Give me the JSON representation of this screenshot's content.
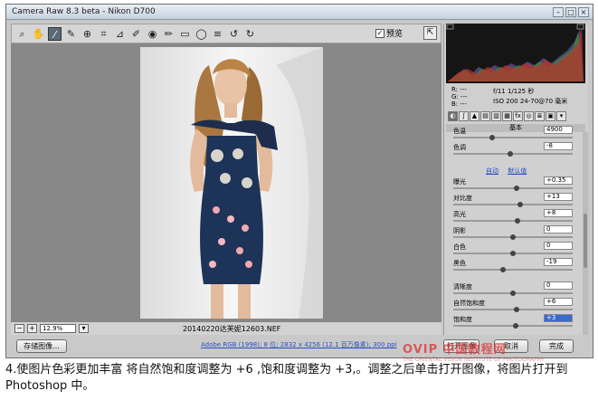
{
  "window": {
    "title": "Camera Raw 8.3 beta - Nikon D700"
  },
  "toolbar": {
    "tools": [
      "zoom-icon",
      "hand-icon",
      "white-balance-icon",
      "color-sampler-icon",
      "target-adjust-icon",
      "crop-icon",
      "straighten-icon",
      "spot-removal-icon",
      "red-eye-icon",
      "adjustment-brush-icon",
      "graduated-filter-icon",
      "radial-filter-icon",
      "preferences-icon",
      "rotate-ccw-icon",
      "rotate-cw-icon"
    ],
    "preview_label": "预览",
    "preview_checked": "✓"
  },
  "histogram": {
    "r": "R:  ---",
    "g": "G:  ---",
    "b": "B:  ---"
  },
  "exif": {
    "line1": "f/11  1/125 秒",
    "line2": "ISO 200  24-70@70 毫米"
  },
  "panel": {
    "section_title": "基本",
    "top_values": {
      "temp_label": "色温",
      "temp_value": "4900",
      "tint_label": "色调",
      "tint_value": "-8"
    },
    "auto_link": "自动",
    "default_link": "默认值",
    "sliders": [
      {
        "label": "曝光",
        "value": "+0.35",
        "pos": 0.53
      },
      {
        "label": "对比度",
        "value": "+13",
        "pos": 0.56
      },
      {
        "label": "高光",
        "value": "+8",
        "pos": 0.54
      },
      {
        "label": "阴影",
        "value": "0",
        "pos": 0.5
      },
      {
        "label": "白色",
        "value": "0",
        "pos": 0.5
      },
      {
        "label": "黑色",
        "value": "-19",
        "pos": 0.41
      },
      {
        "label": "清晰度",
        "value": "0",
        "pos": 0.5
      },
      {
        "label": "自然饱和度",
        "value": "+6",
        "pos": 0.53
      },
      {
        "label": "饱和度",
        "value": "+3",
        "pos": 0.52
      }
    ]
  },
  "zoom": {
    "value": "12.9%",
    "minus": "−",
    "plus": "+"
  },
  "file": {
    "name": "20140220达芙妮12603.NEF"
  },
  "buttons": {
    "save": "存储图像...",
    "open": "打开图像",
    "cancel": "取消",
    "done": "完成"
  },
  "workflow": {
    "text": "Adobe RGB (1998); 8 位; 2832 x 4256 (12.1 百万像素); 300 ppi"
  },
  "watermark": {
    "text": "OVIP 中国教程网",
    "sub": "THE ORIENTAL VISION INSTITUTE OF PHOTOGRAPHY"
  },
  "caption": {
    "text": "4.使图片色彩更加丰富 将自然饱和度调整为 +6 ,饱和度调整为 +3,。调整之后单击打开图像，将图片打开到 Photoshop 中。"
  }
}
